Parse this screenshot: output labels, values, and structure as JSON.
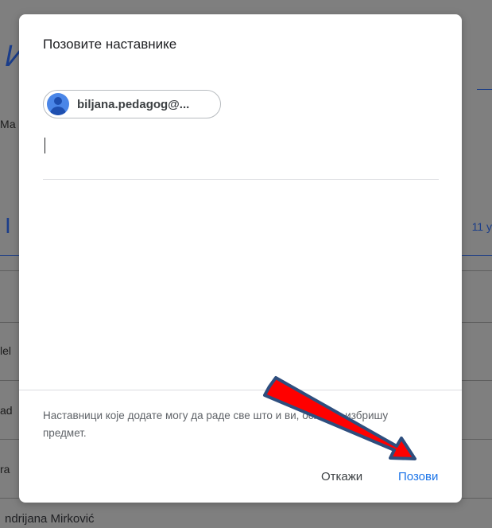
{
  "background": {
    "title_fragment": "И",
    "row1_fragment": "Ма",
    "section_letter": "I",
    "count_fragment": "11 у",
    "row_fragments": [
      "lel",
      "ad",
      "ra"
    ],
    "bottom_name": "ndrijana Mirković"
  },
  "dialog": {
    "title": "Позовите наставнике",
    "chip": {
      "label": "biljana.pedagog@..."
    },
    "note": "Наставници које додате могу да раде све што и ви, осим да избришу предмет.",
    "cancel_label": "Откажи",
    "invite_label": "Позови"
  },
  "annotation": {
    "arrow_fill": "#ff0000",
    "arrow_border": "#2e4e7e"
  }
}
